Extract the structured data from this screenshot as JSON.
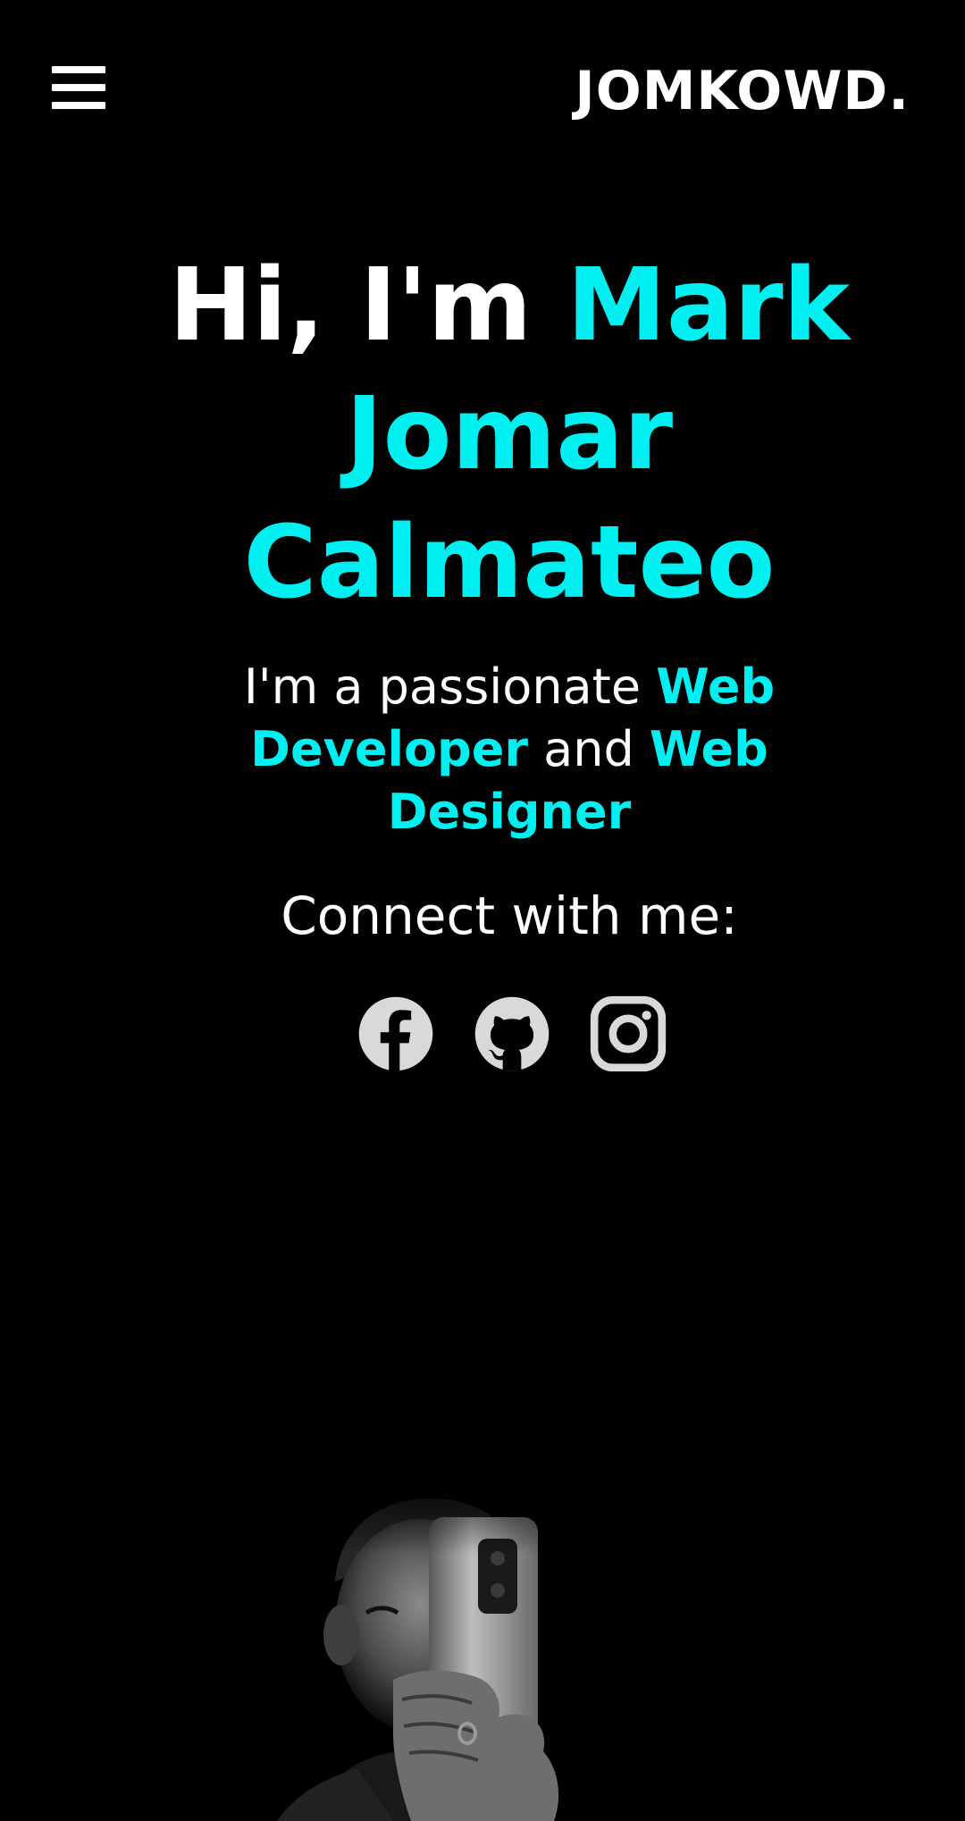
{
  "header": {
    "menu_icon": "hamburger-menu-icon",
    "brand": "JOMKOWD."
  },
  "hero": {
    "greeting": "Hi, I'm ",
    "name_line1": "Mark",
    "name_line2": "Jomar",
    "name_line3": "Calmateo",
    "tagline_prefix": "I'm a passionate ",
    "role1": "Web Developer",
    "tagline_and": " and ",
    "role2": "Web Designer",
    "connect_label": "Connect with me:"
  },
  "social": [
    {
      "icon": "facebook-icon"
    },
    {
      "icon": "github-icon"
    },
    {
      "icon": "instagram-icon"
    }
  ],
  "colors": {
    "background": "#000000",
    "accent": "#00f0f2",
    "text": "#ffffff",
    "icon": "#d9d9d9"
  }
}
